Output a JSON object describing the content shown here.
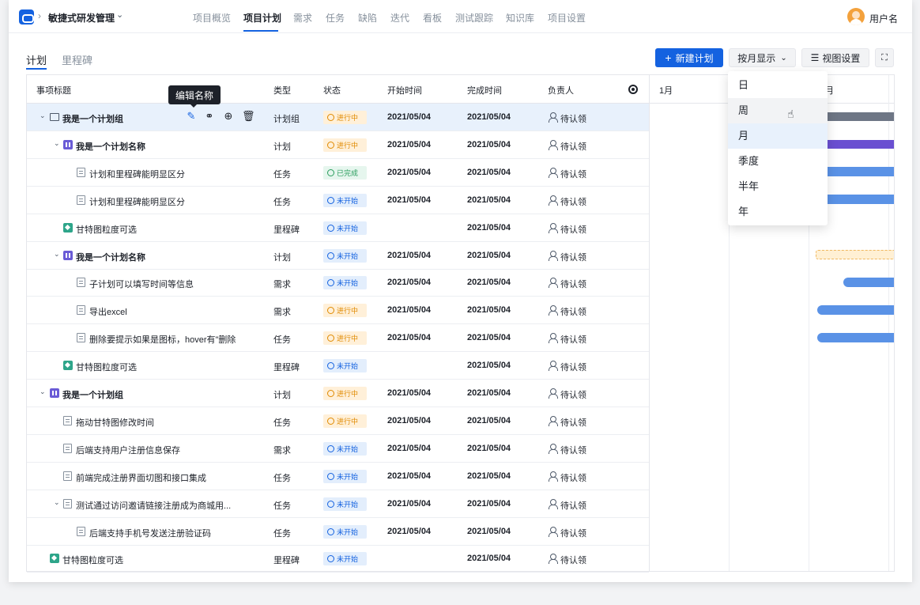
{
  "app": {
    "name": "敏捷式研发管理",
    "user": "用户名"
  },
  "nav": [
    "项目概览",
    "项目计划",
    "需求",
    "任务",
    "缺陷",
    "迭代",
    "看板",
    "测试跟踪",
    "知识库",
    "项目设置"
  ],
  "subtabs": [
    "计划",
    "里程碑"
  ],
  "toolbar": {
    "new_plan": "新建计划",
    "month_display": "按月显示",
    "view_settings": "视图设置"
  },
  "table": {
    "headers": [
      "事项标题",
      "类型",
      "状态",
      "开始时间",
      "完成时间",
      "负责人"
    ],
    "tooltip": "编辑名称",
    "rows": [
      {
        "title": "我是一个计划组",
        "type": "计划组",
        "status": "进行中",
        "start": "2021/05/04",
        "end": "2021/05/04",
        "owner": "待认领"
      },
      {
        "title": "我是一个计划名称",
        "type": "计划",
        "status": "进行中",
        "start": "2021/05/04",
        "end": "2021/05/04",
        "owner": "待认领"
      },
      {
        "title": "计划和里程碑能明显区分",
        "type": "任务",
        "status": "已完成",
        "start": "2021/05/04",
        "end": "2021/05/04",
        "owner": "待认领"
      },
      {
        "title": "计划和里程碑能明显区分",
        "type": "任务",
        "status": "未开始",
        "start": "2021/05/04",
        "end": "2021/05/04",
        "owner": "待认领"
      },
      {
        "title": "甘特图粒度可选",
        "type": "里程碑",
        "status": "未开始",
        "start": "",
        "end": "2021/05/04",
        "owner": "待认领"
      },
      {
        "title": "我是一个计划名称",
        "type": "计划",
        "status": "未开始",
        "start": "2021/05/04",
        "end": "2021/05/04",
        "owner": "待认领"
      },
      {
        "title": "子计划可以填写时间等信息",
        "type": "需求",
        "status": "未开始",
        "start": "2021/05/04",
        "end": "2021/05/04",
        "owner": "待认领"
      },
      {
        "title": "导出excel",
        "type": "需求",
        "status": "进行中",
        "start": "2021/05/04",
        "end": "2021/05/04",
        "owner": "待认领"
      },
      {
        "title": "删除要提示如果是图标，hover有\"删除",
        "type": "任务",
        "status": "进行中",
        "start": "2021/05/04",
        "end": "2021/05/04",
        "owner": "待认领"
      },
      {
        "title": "甘特图粒度可选",
        "type": "里程碑",
        "status": "未开始",
        "start": "",
        "end": "2021/05/04",
        "owner": "待认领"
      },
      {
        "title": "我是一个计划组",
        "type": "计划",
        "status": "进行中",
        "start": "2021/05/04",
        "end": "2021/05/04",
        "owner": "待认领"
      },
      {
        "title": "拖动甘特图修改时间",
        "type": "任务",
        "status": "进行中",
        "start": "2021/05/04",
        "end": "2021/05/04",
        "owner": "待认领"
      },
      {
        "title": "后端支持用户注册信息保存",
        "type": "需求",
        "status": "未开始",
        "start": "2021/05/04",
        "end": "2021/05/04",
        "owner": "待认领"
      },
      {
        "title": "前端完成注册界面切图和接口集成",
        "type": "任务",
        "status": "未开始",
        "start": "2021/05/04",
        "end": "2021/05/04",
        "owner": "待认领"
      },
      {
        "title": "测试通过访问邀请链接注册成为商城用...",
        "type": "任务",
        "status": "未开始",
        "start": "2021/05/04",
        "end": "2021/05/04",
        "owner": "待认领"
      },
      {
        "title": "后端支持手机号发送注册验证码",
        "type": "任务",
        "status": "未开始",
        "start": "2021/05/04",
        "end": "2021/05/04",
        "owner": "待认领"
      },
      {
        "title": "甘特图粒度可选",
        "type": "里程碑",
        "status": "未开始",
        "start": "",
        "end": "2021/05/04",
        "owner": "待认领"
      }
    ]
  },
  "gantt": {
    "month1": "1月",
    "month3_partial": "月"
  },
  "dropdown": {
    "options": [
      "日",
      "周",
      "月",
      "季度",
      "半年",
      "年"
    ],
    "selected": "月"
  },
  "colors": {
    "primary": "#1462e0",
    "in_progress": "#e08a00",
    "done": "#2a9d5d",
    "todo": "#1462e0"
  }
}
